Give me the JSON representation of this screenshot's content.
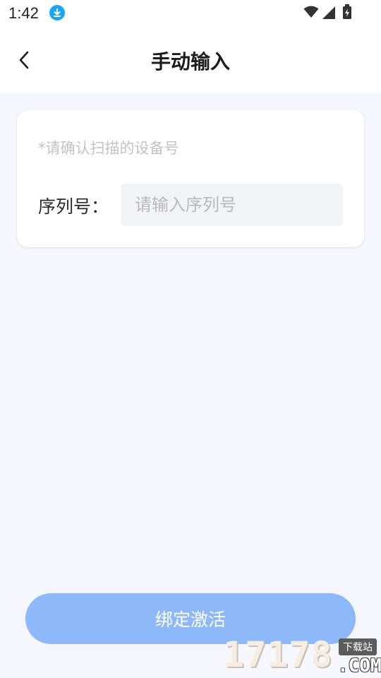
{
  "status_bar": {
    "time": "1:42",
    "icons": [
      "download-icon",
      "wifi-icon",
      "signal-icon",
      "battery-icon"
    ]
  },
  "header": {
    "title": "手动输入",
    "back_icon": "chevron-left-icon"
  },
  "card": {
    "hint": "*请确认扫描的设备号",
    "serial_label": "序列号：",
    "serial_value": "",
    "serial_placeholder": "请输入序列号"
  },
  "bind_button": {
    "label": "绑定激活"
  },
  "watermark": {
    "number": "17178",
    "badge": "下载站",
    "domain": ".COM"
  },
  "colors": {
    "background": "#f6f7fc",
    "button": "#8db9fb",
    "download_badge": "#19a7f5"
  }
}
